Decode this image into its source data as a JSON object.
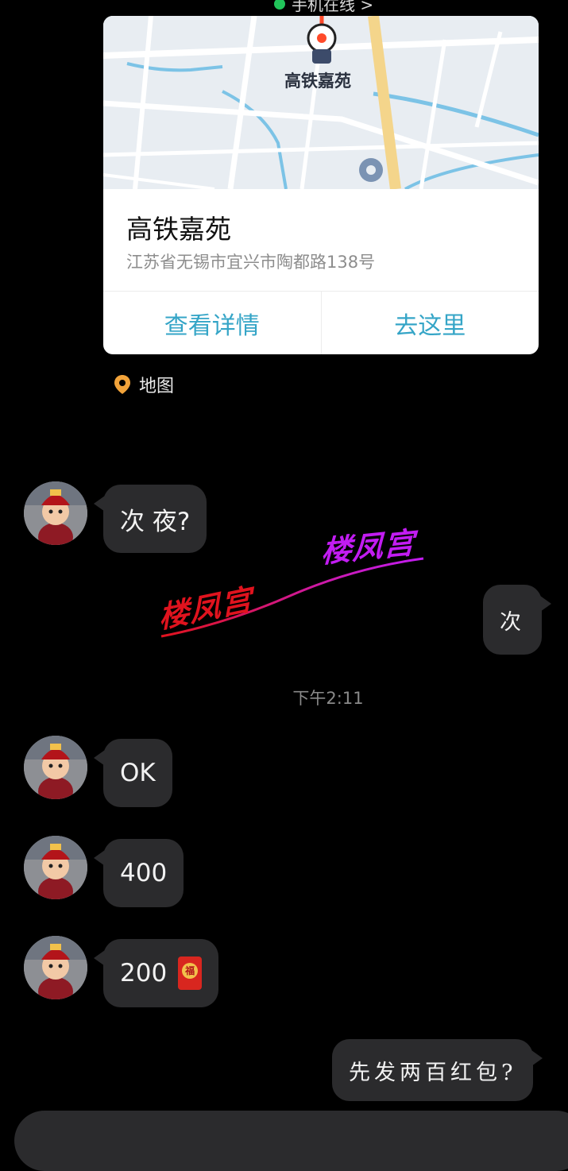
{
  "status_line": {
    "text": "手机在线 >"
  },
  "location_card": {
    "map_poi_label": "高铁嘉苑",
    "title": "高铁嘉苑",
    "address": "江苏省无锡市宜兴市陶都路138号",
    "actions": [
      "查看详情",
      "去这里"
    ]
  },
  "map_tag": {
    "label": "地图",
    "icon": "location-pin-icon",
    "icon_color": "#f2a33a"
  },
  "watermark": {
    "text_1": "楼凤宫",
    "text_2": "楼凤宫",
    "colors": [
      "#c21cf2",
      "#e0131e"
    ]
  },
  "messages": [
    {
      "side": "left",
      "text": "次 夜?"
    },
    {
      "side": "right",
      "text": "次"
    },
    {
      "side": "left",
      "text": "OK"
    },
    {
      "side": "left",
      "text": "400"
    },
    {
      "side": "left",
      "text": "200",
      "attachment": "red-packet-icon"
    },
    {
      "side": "right",
      "text": "先发两百红包?"
    }
  ],
  "timestamp": "下午2:11",
  "colors": {
    "background": "#000000",
    "bubble": "#2b2b2d",
    "link": "#35a5c7"
  }
}
